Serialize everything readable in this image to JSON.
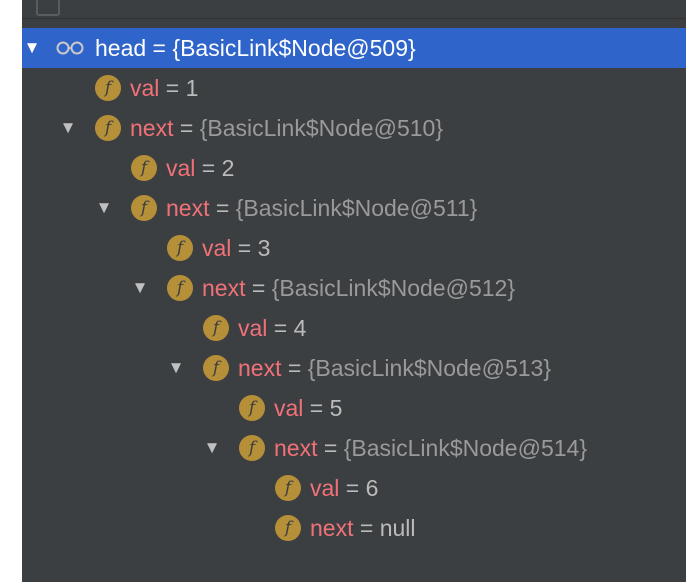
{
  "rows": [
    {
      "name": "head",
      "eq": " = ",
      "value": "{BasicLink$Node@509}"
    },
    {
      "name": "val",
      "eq": " = ",
      "value": "1"
    },
    {
      "name": "next",
      "eq": " = ",
      "value": "{BasicLink$Node@510}"
    },
    {
      "name": "val",
      "eq": " = ",
      "value": "2"
    },
    {
      "name": "next",
      "eq": " = ",
      "value": "{BasicLink$Node@511}"
    },
    {
      "name": "val",
      "eq": " = ",
      "value": "3"
    },
    {
      "name": "next",
      "eq": " = ",
      "value": "{BasicLink$Node@512}"
    },
    {
      "name": "val",
      "eq": " = ",
      "value": "4"
    },
    {
      "name": "next",
      "eq": " = ",
      "value": "{BasicLink$Node@513}"
    },
    {
      "name": "val",
      "eq": " = ",
      "value": "5"
    },
    {
      "name": "next",
      "eq": " = ",
      "value": "{BasicLink$Node@514}"
    },
    {
      "name": "val",
      "eq": " = ",
      "value": "6"
    },
    {
      "name": "next",
      "eq": " = ",
      "value": "null"
    }
  ],
  "icons": {
    "expand": "▼",
    "field": "f"
  },
  "colors": {
    "panel_bg": "#3c3f41",
    "selection": "#2f65ca",
    "field_name": "#f07178",
    "field_icon": "#b59038"
  }
}
